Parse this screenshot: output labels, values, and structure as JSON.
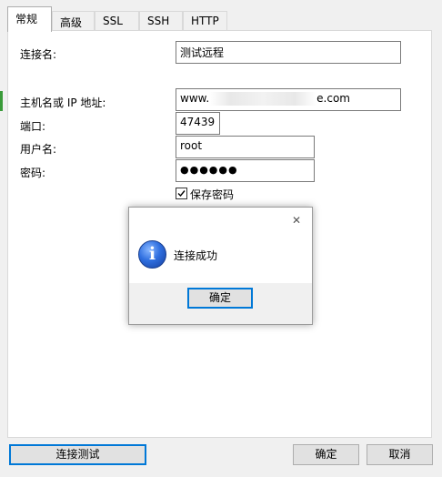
{
  "tabs": [
    "常规",
    "高级",
    "SSL",
    "SSH",
    "HTTP"
  ],
  "form": {
    "connection_name_label": "连接名:",
    "connection_name_value": "测试远程",
    "host_label": "主机名或 IP 地址:",
    "host_value_prefix": "www.",
    "host_value_suffix": "e.com",
    "port_label": "端口:",
    "port_value": "47439",
    "username_label": "用户名:",
    "username_value": "root",
    "password_label": "密码:",
    "password_value": "●●●●●●",
    "save_password_label": "保存密码",
    "save_password_checked": true
  },
  "dialog": {
    "message": "连接成功",
    "ok_label": "确定",
    "close_glyph": "✕",
    "icon": "info-icon"
  },
  "footer": {
    "test_connection_label": "连接测试",
    "ok_label": "确定",
    "cancel_label": "取消"
  },
  "colors": {
    "accent": "#0078d7",
    "panel_bg": "#ffffff",
    "window_bg": "#f0f0f0"
  }
}
